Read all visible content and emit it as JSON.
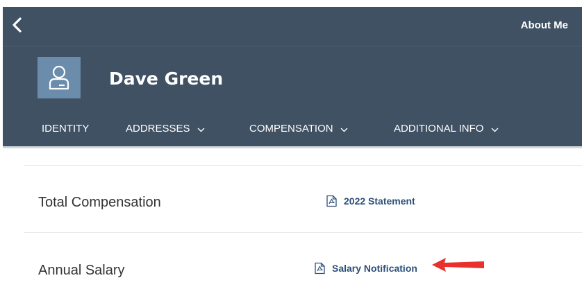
{
  "header": {
    "page_title": "About Me",
    "employee_name": "Dave Green"
  },
  "tabs": [
    {
      "label": "IDENTITY",
      "has_dropdown": false
    },
    {
      "label": "ADDRESSES",
      "has_dropdown": true
    },
    {
      "label": "COMPENSATION",
      "has_dropdown": true
    },
    {
      "label": "ADDITIONAL INFO",
      "has_dropdown": true
    }
  ],
  "rows": [
    {
      "label": "Total Compensation",
      "link": "2022 Statement",
      "link_icon": "pdf-document-icon"
    },
    {
      "label": "Annual Salary",
      "link": "Salary Notification",
      "link_icon": "pdf-document-icon"
    }
  ],
  "colors": {
    "header_bg": "#3f5163",
    "avatar_bg": "#6b8dab",
    "link_text": "#2c4f79",
    "annotation_arrow": "#e8302c"
  },
  "icons": {
    "back": "chevron-left-icon",
    "avatar": "user-icon",
    "dropdown": "chevron-down-icon"
  }
}
